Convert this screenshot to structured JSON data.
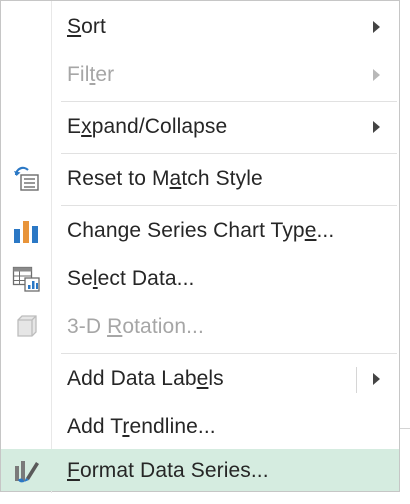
{
  "menu": {
    "items": [
      {
        "label": "Sort",
        "mnemonic_index": 0,
        "icon": "",
        "enabled": true,
        "submenu": true
      },
      {
        "label": "Filter",
        "mnemonic_index": 3,
        "icon": "",
        "enabled": false,
        "submenu": true
      },
      {
        "label": "Expand/Collapse",
        "mnemonic_index": 1,
        "icon": "",
        "enabled": true,
        "submenu": true
      },
      {
        "label": "Reset to Match Style",
        "mnemonic_index": 10,
        "icon": "reset-style-icon",
        "enabled": true,
        "submenu": false
      },
      {
        "label": "Change Series Chart Type...",
        "mnemonic_index": 23,
        "icon": "bar-chart-icon",
        "enabled": true,
        "submenu": false
      },
      {
        "label": "Select Data...",
        "mnemonic_index": 2,
        "icon": "select-data-icon",
        "enabled": true,
        "submenu": false
      },
      {
        "label": "3-D Rotation...",
        "mnemonic_index": 4,
        "icon": "3d-rotation-icon",
        "enabled": false,
        "submenu": false
      },
      {
        "label": "Add Data Labels",
        "mnemonic_index": 12,
        "icon": "",
        "enabled": true,
        "submenu": true
      },
      {
        "label": "Add Trendline...",
        "mnemonic_index": 5,
        "icon": "",
        "enabled": true,
        "submenu": false
      },
      {
        "label": "Format Data Series...",
        "mnemonic_index": 0,
        "icon": "format-series-icon",
        "enabled": true,
        "submenu": false,
        "highlighted": true
      }
    ]
  },
  "colors": {
    "highlight": "#d5ece0",
    "text": "#262626",
    "disabled_text": "#a6a6a6",
    "chart_blue": "#2b78c5",
    "chart_orange": "#e8943a"
  }
}
